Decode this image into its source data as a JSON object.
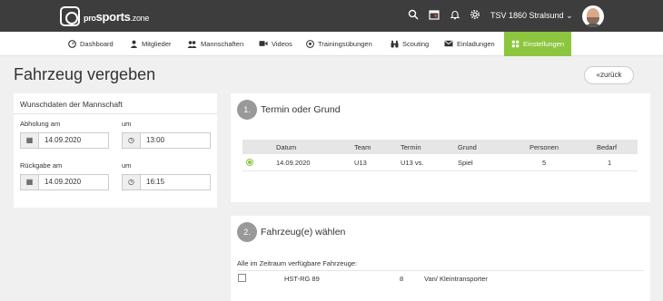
{
  "header": {
    "logo_pro": "pro",
    "logo_sports": "sports",
    "logo_zone": ".zone",
    "club": "TSV 1860 Stralsund",
    "icons": [
      "search-icon",
      "calendar-icon",
      "bell-icon",
      "gear-icon"
    ]
  },
  "nav": {
    "items": [
      {
        "label": "Dashboard",
        "icon": "dashboard-icon"
      },
      {
        "label": "Mitglieder",
        "icon": "user-icon"
      },
      {
        "label": "Mannschaften",
        "icon": "users-icon"
      },
      {
        "label": "Videos",
        "icon": "video-icon"
      },
      {
        "label": "Trainingsübungen",
        "icon": "football-icon"
      },
      {
        "label": "Scouting",
        "icon": "binoculars-icon"
      },
      {
        "label": "Einladungen",
        "icon": "envelope-icon"
      },
      {
        "label": "Einstellungen",
        "icon": "settings-grid-icon"
      }
    ],
    "active_color": "#8cc63f"
  },
  "page": {
    "title": "Fahrzeug vergeben",
    "back_label": "zurück"
  },
  "wishdates": {
    "title": "Wunschdaten der Mannschaft",
    "pickup_label": "Abholung am",
    "pickup_time_label": "um",
    "pickup_date": "14.09.2020",
    "pickup_time": "13:00",
    "return_label": "Rückgabe am",
    "return_time_label": "um",
    "return_date": "14.09.2020",
    "return_time": "16:15"
  },
  "step1": {
    "number": "1.",
    "title": "Termin oder Grund",
    "columns": [
      "Datum",
      "Team",
      "Termin",
      "Grund",
      "Personen",
      "Bedarf"
    ],
    "rows": [
      {
        "datum": "14.09.2020",
        "team": "U13",
        "termin": "U13 vs.",
        "grund": "Spiel",
        "personen": "5",
        "bedarf": "1",
        "selected": true
      }
    ]
  },
  "step2": {
    "number": "2.",
    "title": "Fahrzeug(e) wählen",
    "subtitle": "Alle im Zeitraum verfügbare Fahrzeuge:",
    "vehicles": [
      {
        "plate": "HST-RG 89",
        "seats": "8",
        "type": "Van/ Kleintransporter",
        "checked": false
      }
    ]
  }
}
